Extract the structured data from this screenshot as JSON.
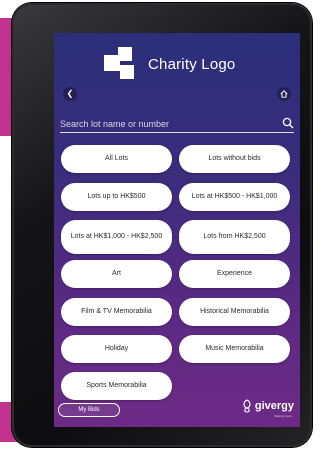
{
  "brand": {
    "logo_text": "Charity Logo"
  },
  "nav": {
    "back_icon": "chevron-left-icon",
    "home_icon": "home-icon"
  },
  "search": {
    "placeholder": "Search lot name or number",
    "icon": "search-icon"
  },
  "categories": [
    "All Lots",
    "Lots without bids",
    "Lots up to HK$500",
    "Lots at HK$500 - HK$1,000",
    "Lots at HK$1,000 - HK$2,500",
    "Lots from HK$2,500",
    "Art",
    "Experience",
    "Film & TV Memorabilia",
    "Historical Memorabilia",
    "Holiday",
    "Music Memorabilia",
    "Sports Memorabilia"
  ],
  "footer": {
    "my_bids_label": "My Bids",
    "givergy_brand": "givergy",
    "givergy_tagline": "Raising more"
  },
  "colors": {
    "screen_gradient_top": "#2b2f7a",
    "screen_gradient_bottom": "#6d2a86",
    "accent_magenta": "#c2318d"
  }
}
